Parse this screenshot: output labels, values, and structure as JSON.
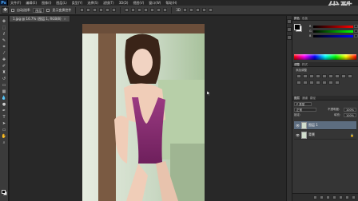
{
  "app": {
    "logo": "Ps"
  },
  "menu": [
    "文件(F)",
    "编辑(E)",
    "图像(I)",
    "图层(L)",
    "类型(Y)",
    "选择(S)",
    "滤镜(T)",
    "3D(D)",
    "视图(V)",
    "窗口(W)",
    "帮助(H)"
  ],
  "options": {
    "auto_select_label": "自动选择:",
    "auto_select_value": "图层",
    "show_transform_label": "显示变换控件"
  },
  "watermark": "优酷",
  "document": {
    "tab_title": "1.jpg @ 16.7% (图层 1, RGB/8)",
    "close": "×"
  },
  "panels": {
    "color_tabs": [
      "颜色",
      "色板"
    ],
    "color_labels": [
      "R",
      "G",
      "B"
    ],
    "foreground_color": "#000000",
    "background_color": "#ffffff",
    "channels": {
      "R": 0,
      "G": 0,
      "B": 0
    },
    "adjust_tabs": [
      "调整",
      "样式"
    ],
    "adjust_title": "添加调整",
    "layer_tabs": [
      "图层",
      "通道",
      "路径"
    ],
    "kind_filter": "P 类型",
    "blend_mode": "正常",
    "opacity_label": "不透明度:",
    "opacity_value": "100%",
    "lock_label": "锁定:",
    "fill_label": "填充:",
    "fill_value": "100%",
    "layers": [
      {
        "name": "图层 1",
        "selected": true,
        "lock": ""
      },
      {
        "name": "背景",
        "selected": false,
        "lock": "🔒"
      }
    ]
  }
}
